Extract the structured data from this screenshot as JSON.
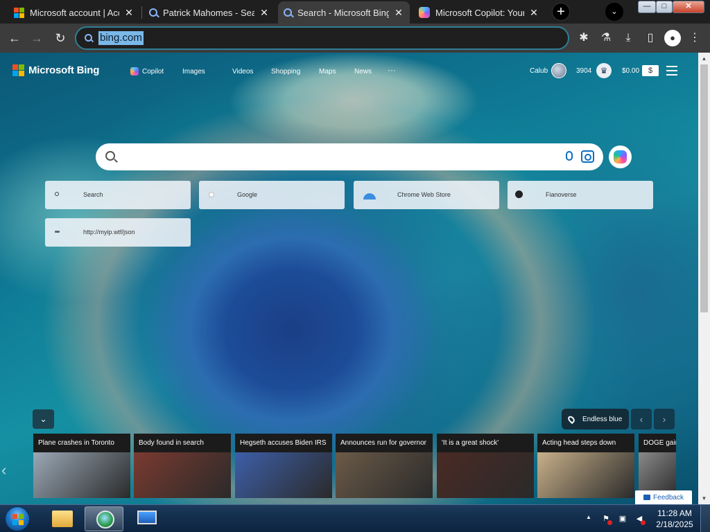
{
  "browser": {
    "tabs": [
      {
        "title": "Microsoft account | Acc",
        "favicon": "microsoft-logo-icon",
        "active": false
      },
      {
        "title": "Patrick Mahomes - Sear",
        "favicon": "search-icon",
        "active": false
      },
      {
        "title": "Search - Microsoft Bing",
        "favicon": "search-icon",
        "active": true
      },
      {
        "title": "Microsoft Copilot: Your",
        "favicon": "copilot-icon",
        "active": false
      }
    ],
    "tab_close_glyph": "✕",
    "new_tab_glyph": "+",
    "tab_search_glyph": "⌄",
    "window_controls": {
      "minimize": "—",
      "maximize": "□",
      "close": "✕"
    },
    "nav": {
      "back": "←",
      "forward": "→",
      "reload": "↻"
    },
    "address": {
      "url": "bing.com"
    },
    "toolbar_icons": {
      "extensions": "✱",
      "labs": "⚗",
      "download": "⤓",
      "side_panel": "▯",
      "profile": "●",
      "menu": "⋮"
    }
  },
  "bing": {
    "logo_text": "Microsoft Bing",
    "ms_logo_colors": [
      "#f25022",
      "#7fba00",
      "#00a4ef",
      "#ffb900"
    ],
    "nav": [
      "Copilot",
      "Images",
      "Videos",
      "Shopping",
      "Maps",
      "News"
    ],
    "more": "···",
    "user_name": "Calub",
    "points": "3904",
    "balance": "$0.00",
    "wallet_glyph": "$",
    "rewards_glyph": "♛",
    "search": {
      "value": "",
      "placeholder": ""
    },
    "tiles": [
      {
        "label": "Search"
      },
      {
        "label": "Google"
      },
      {
        "label": "Chrome Web Store"
      },
      {
        "label": "Fianoverse"
      },
      {
        "label": "http://myip.wtf/json"
      }
    ],
    "collapse_glyph": "⌄",
    "location": "Endless blue",
    "prev_glyph": "‹",
    "next_glyph": "›",
    "news_left_glyph": "‹",
    "news": [
      {
        "title": "Plane crashes in Toronto",
        "color": "#9aa8b6"
      },
      {
        "title": "Body found in search",
        "color": "#7a3a30"
      },
      {
        "title": "Hegseth accuses Biden IRS",
        "color": "#3d5fa8"
      },
      {
        "title": "Announces run for governor",
        "color": "#6b5a48"
      },
      {
        "title": "'It is a great shock'",
        "color": "#4a2a24"
      },
      {
        "title": "Acting head steps down",
        "color": "#c8b08a"
      },
      {
        "title": "DOGE gains",
        "color": "#8a8a8a"
      }
    ],
    "feedback": "Feedback"
  },
  "scrollbar": {
    "up": "▲",
    "down": "▼"
  },
  "taskbar": {
    "flag_colors": [
      "#f25022",
      "#7fba00",
      "#00a4ef",
      "#ffb900"
    ],
    "tray_up": "▲",
    "time": "11:28 AM",
    "date": "2/18/2025"
  }
}
